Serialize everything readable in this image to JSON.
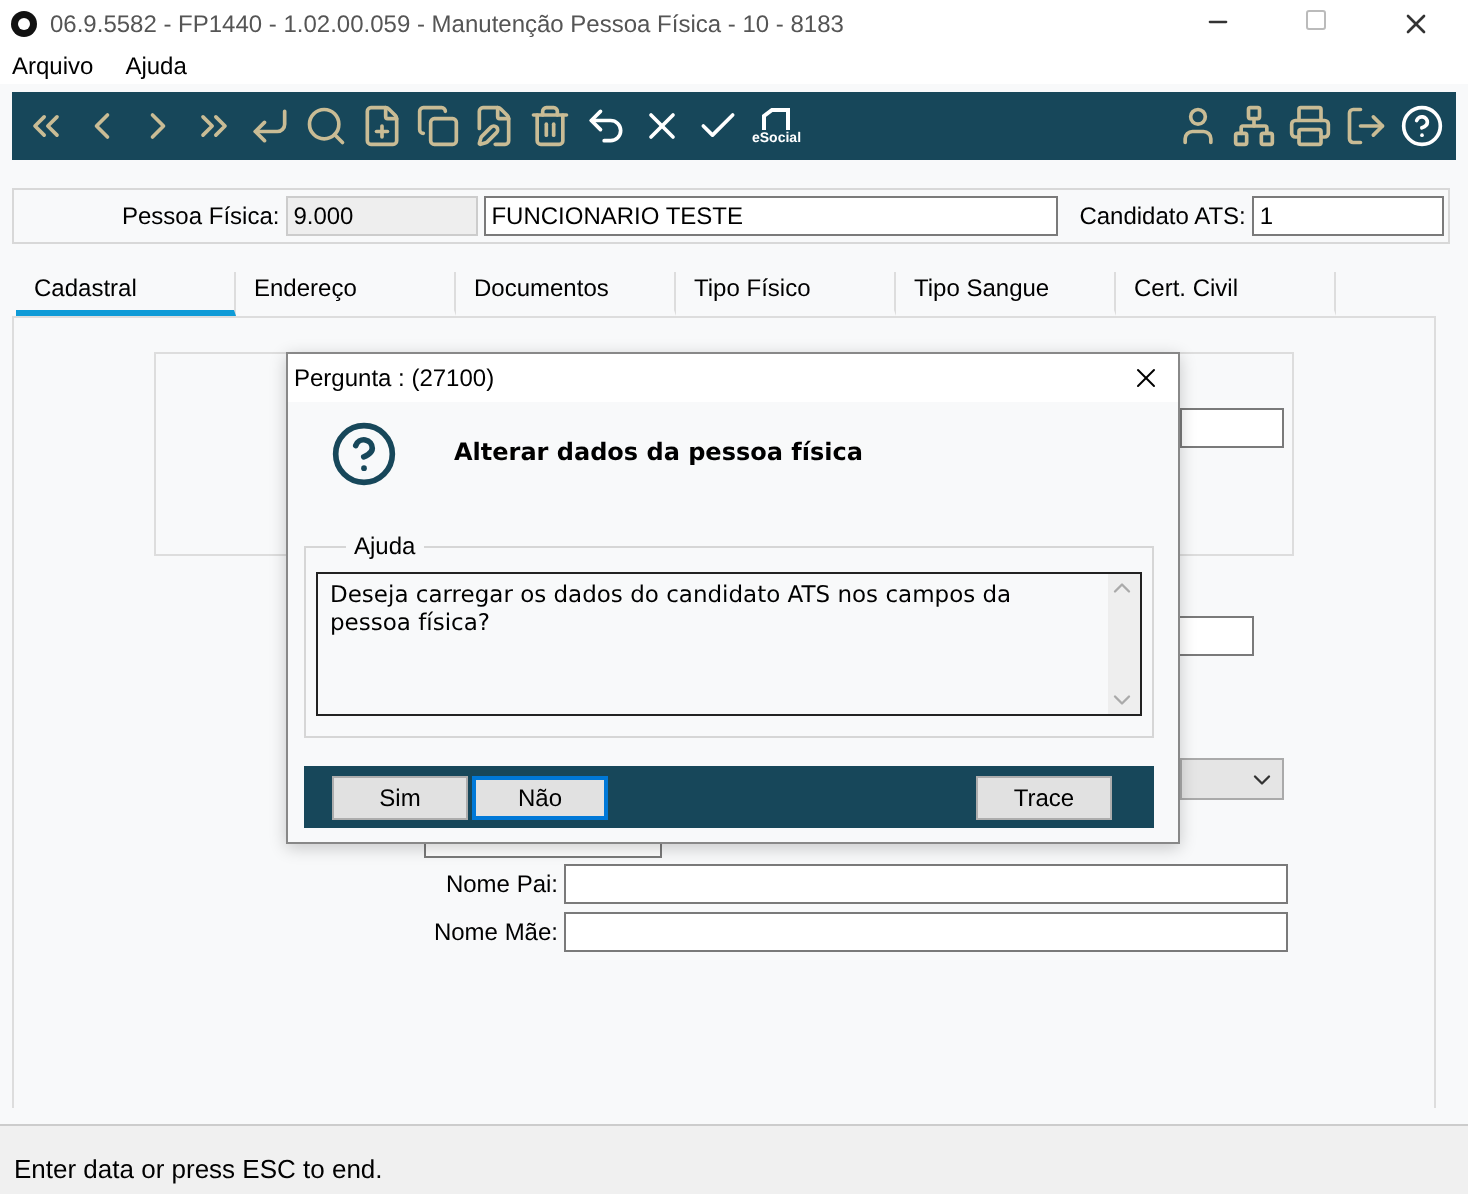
{
  "window": {
    "title": "06.9.5582 - FP1440 - 1.02.00.059 - Manutenção Pessoa Física - 10 - 8183"
  },
  "menu": [
    "Arquivo",
    "Ajuda"
  ],
  "toolbar": {
    "esocial_label": "eSocial"
  },
  "header": {
    "person_label": "Pessoa Física:",
    "person_code": "9.000",
    "person_name": "FUNCIONARIO TESTE",
    "candidate_label": "Candidato ATS:",
    "candidate_value": "1"
  },
  "tabs": [
    {
      "label": "Cadastral",
      "selected": true
    },
    {
      "label": "Endereço",
      "selected": false
    },
    {
      "label": "Documentos",
      "selected": false
    },
    {
      "label": "Tipo Físico",
      "selected": false
    },
    {
      "label": "Tipo Sangue",
      "selected": false
    },
    {
      "label": "Cert. Civil",
      "selected": false
    }
  ],
  "form": {
    "father_label": "Nome Pai:",
    "mother_label": "Nome Mãe:"
  },
  "dialog": {
    "title": "Pergunta : (27100)",
    "heading": "Alterar dados da pessoa física",
    "group_label": "Ajuda",
    "message": "Deseja carregar os dados do candidato ATS nos campos da pessoa física?",
    "buttons": [
      {
        "label": "Sim",
        "focused": false
      },
      {
        "label": "Não",
        "focused": true
      },
      {
        "label": "Trace",
        "focused": false
      }
    ]
  },
  "status_bar": "Enter data or press ESC to end."
}
